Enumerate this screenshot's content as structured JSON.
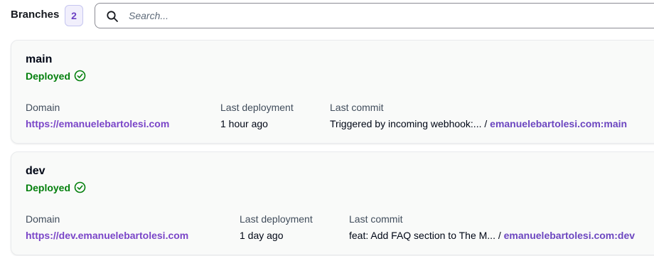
{
  "header": {
    "title": "Branches",
    "count": "2",
    "search": {
      "placeholder": "Search...",
      "value": ""
    }
  },
  "labels": {
    "domain": "Domain",
    "last_deployment": "Last deployment",
    "last_commit": "Last commit"
  },
  "branches": [
    {
      "name": "main",
      "status": "Deployed",
      "domain": "https://emanuelebartolesi.com",
      "last_deployment": "1 hour ago",
      "commit_message": "Triggered by incoming webhook:...",
      "commit_separator": "/",
      "commit_ref": "emanuelebartolesi.com:main"
    },
    {
      "name": "dev",
      "status": "Deployed",
      "domain": "https://dev.emanuelebartolesi.com",
      "last_deployment": "1 day ago",
      "commit_message": "feat: Add FAQ section to The M...",
      "commit_separator": "/",
      "commit_ref": "emanuelebartolesi.com:dev"
    }
  ],
  "colors": {
    "accent_purple": "#7a45c8",
    "success_green": "#037f0c",
    "card_background": "#f9faf9"
  },
  "icons": {
    "search": "search-icon",
    "status": "check-circle-icon"
  }
}
